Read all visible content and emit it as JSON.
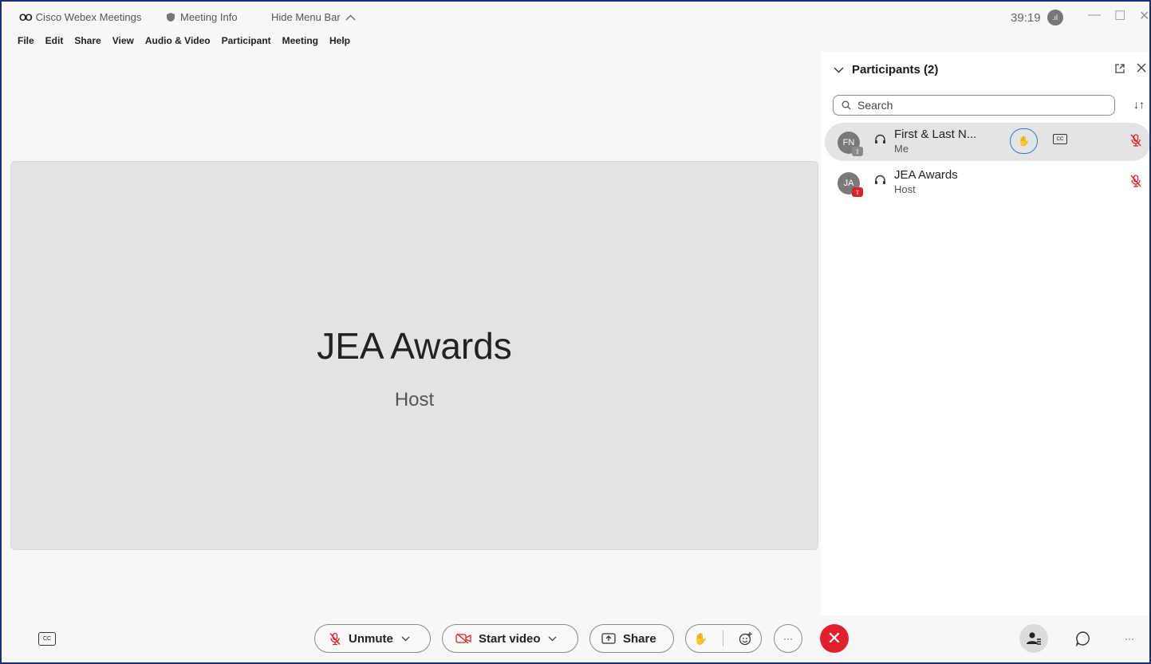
{
  "titlebar": {
    "app_name": "Cisco Webex Meetings",
    "meeting_info": "Meeting Info",
    "hide_menu": "Hide Menu Bar",
    "timer": "39:19"
  },
  "menu": [
    "File",
    "Edit",
    "Share",
    "View",
    "Audio & Video",
    "Participant",
    "Meeting",
    "Help"
  ],
  "stage": {
    "name": "JEA Awards",
    "role": "Host"
  },
  "panel": {
    "title": "Participants (2)",
    "search_placeholder": "Search",
    "participants": [
      {
        "initials": "FN",
        "name": "First & Last N...",
        "role": "Me",
        "badge_color": "#8a8a8a"
      },
      {
        "initials": "JA",
        "name": "JEA Awards",
        "role": "Host",
        "badge_color": "#d8232a"
      }
    ]
  },
  "controls": {
    "unmute": "Unmute",
    "start_video": "Start video",
    "share": "Share",
    "more": "···"
  },
  "colors": {
    "accent": "#2b78d4",
    "end_call": "#e0202e",
    "mute_red": "#d8232a"
  }
}
